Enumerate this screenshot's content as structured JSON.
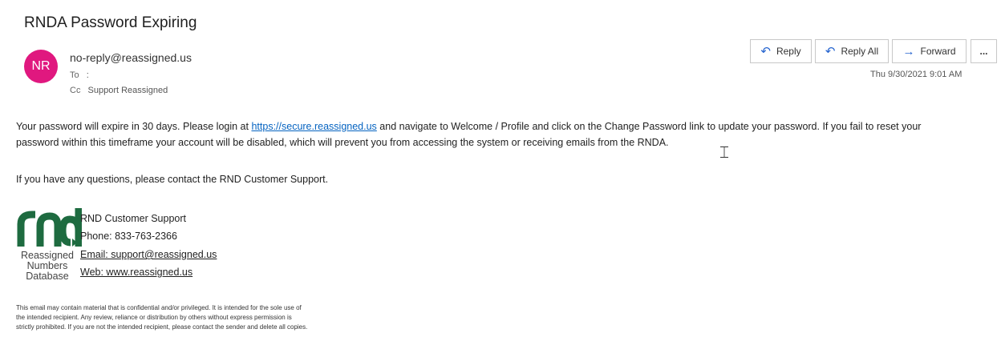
{
  "email": {
    "subject": "RNDA Password Expiring",
    "avatar_initials": "NR",
    "avatar_color": "#e0187f",
    "from": "no-reply@reassigned.us",
    "to_label": "To",
    "to_value": ":",
    "cc_label": "Cc",
    "cc_value": "Support Reassigned",
    "date": "Thu 9/30/2021 9:01 AM"
  },
  "actions": {
    "reply_label": "Reply",
    "reply_all_label": "Reply All",
    "forward_label": "Forward",
    "more_label": "...",
    "reply_icon": "reply-icon",
    "reply_all_icon": "reply-all-icon",
    "forward_icon": "forward-icon"
  },
  "body": {
    "p1_before": "Your password will expire in 30 days. Please login at",
    "p1_link": "https://secure.reassigned.us",
    "p1_after": "and navigate to Welcome / Profile and click on the Change Password link to update your password. If you fail to reset your",
    "p1_line2": "password within this timeframe your account will be disabled, which will prevent you from accessing the system or receiving emails from the RNDA.",
    "p2": "If you have any questions, please contact the RND Customer Support."
  },
  "signature": {
    "logo_line1": "Reassigned",
    "logo_line2": "Numbers",
    "logo_line3": "Database",
    "name": "RND Customer Support",
    "phone": "Phone: 833-763-2366",
    "email": "Email: support@reassigned.us",
    "web": "Web: www.reassigned.us",
    "logo_color": "#1e6b40"
  },
  "disclaimer": {
    "line1": "This email may contain material that is confidential and/or privileged. It is intended for the sole use of",
    "line2": "the intended recipient. Any review, reliance or distribution by others without express permission is",
    "line3": "strictly prohibited. If you are not the intended recipient, please contact the sender and delete all copies."
  },
  "colors": {
    "accent": "#2564cf",
    "link": "#0563c1"
  }
}
